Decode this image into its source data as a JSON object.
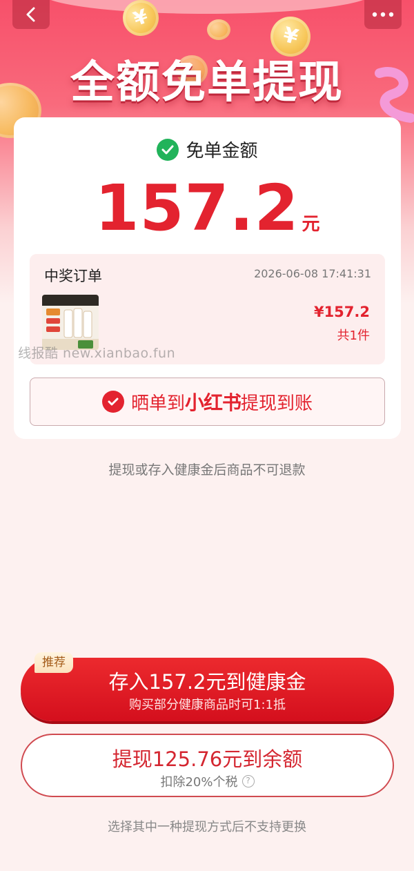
{
  "hero": {
    "title": "全额免单提现"
  },
  "nav": {
    "back_icon": "chevron-left-icon",
    "more_icon": "more-dots-icon"
  },
  "summary": {
    "label": "免单金额",
    "amount": "157.2",
    "unit": "元"
  },
  "order": {
    "title": "中奖订单",
    "time": "2026-06-08 17:41:31",
    "price": "¥157.2",
    "count": "共1件"
  },
  "share": {
    "prefix": "晒单到",
    "brand": "小红书",
    "suffix": "提现到账"
  },
  "watermark": "线报酷 new.xianbao.fun",
  "notes": {
    "refund": "提现或存入健康金后商品不可退款",
    "choose": "选择其中一种提现方式后不支持更换"
  },
  "options": {
    "recommend_tag": "推荐",
    "primary_main": "存入157.2元到健康金",
    "primary_sub": "购买部分健康商品时可1:1抵",
    "secondary_main": "提现125.76元到余额",
    "secondary_sub": "扣除20%个税"
  },
  "colors": {
    "accent_red": "#e3232f",
    "success_green": "#21b35a",
    "tag_brown": "#a35a17"
  }
}
